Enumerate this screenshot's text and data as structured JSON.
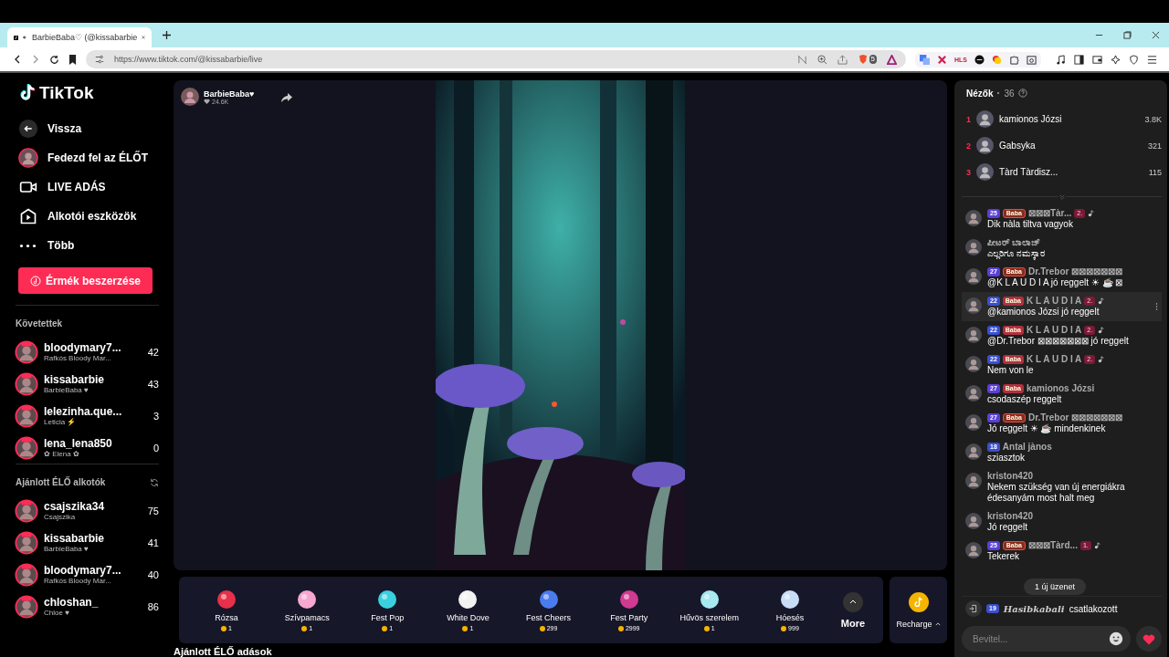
{
  "browser": {
    "tab_title": "BarbieBaba♡ (@kissabarbie",
    "url": "https://www.tiktok.com/@kissabarbie/live",
    "extension_label": "HLS",
    "shield_count": "5"
  },
  "sidebar": {
    "logo": "TikTok",
    "nav": [
      {
        "kind": "back",
        "label": "Vissza"
      },
      {
        "kind": "avatar",
        "label": "Fedezd fel az ÉLŐT"
      },
      {
        "kind": "camera",
        "label": "LIVE ADÁS"
      },
      {
        "kind": "play",
        "label": "Alkotói eszközök"
      },
      {
        "kind": "dots",
        "label": "Több"
      }
    ],
    "coins_button": "Érmék beszerzése",
    "sections": [
      {
        "title": "Követettek",
        "refresh": false,
        "items": [
          {
            "name": "bloodymary7...",
            "subtitle": "Rafkós Bloody Mar...",
            "count": "42",
            "live": true
          },
          {
            "name": "kissabarbie",
            "subtitle": "BarbieBaba ♥",
            "count": "43",
            "live": true
          },
          {
            "name": "lelezinha.que...",
            "subtitle": "Leticia ⚡",
            "count": "3",
            "live": true
          },
          {
            "name": "lena_lena850",
            "subtitle": "✿ Elena ✿",
            "count": "0",
            "live": true
          }
        ]
      },
      {
        "title": "Ajánlott ÉLŐ alkotók",
        "refresh": true,
        "items": [
          {
            "name": "csajszika34",
            "subtitle": "Csajszika",
            "count": "75",
            "live": true
          },
          {
            "name": "kissabarbie",
            "subtitle": "BarbieBaba ♥",
            "count": "41",
            "live": true
          },
          {
            "name": "bloodymary7...",
            "subtitle": "Rafkós Bloody Mar...",
            "count": "40",
            "live": true
          },
          {
            "name": "chloshan_",
            "subtitle": "Chloe ♥",
            "count": "86",
            "live": true
          }
        ]
      }
    ]
  },
  "stream": {
    "host_name": "BarbieBaba♥",
    "likes": "24.6K"
  },
  "gifts": [
    {
      "name": "Rózsa",
      "price": "1",
      "color": "#e8304a"
    },
    {
      "name": "Szívpamacs",
      "price": "1",
      "color": "#f7a8d0"
    },
    {
      "name": "Fest Pop",
      "price": "1",
      "color": "#3ad0e0"
    },
    {
      "name": "White Dove",
      "price": "1",
      "color": "#f2f2f2"
    },
    {
      "name": "Fest Cheers",
      "price": "299",
      "color": "#4a7cf0"
    },
    {
      "name": "Fest Party",
      "price": "2999",
      "color": "#d03a90"
    },
    {
      "name": "Hűvös szerelem",
      "price": "1",
      "color": "#a8e8f0"
    },
    {
      "name": "Hóesés",
      "price": "999",
      "color": "#c8dcf8"
    }
  ],
  "more_button": "More",
  "recharge_button": "Recharge",
  "below_heading": "Ajánlott ÉLŐ adások",
  "viewers": {
    "title": "Nézők",
    "count": "36",
    "top": [
      {
        "rank": "1",
        "name": "kamionos Józsi",
        "score": "3.8K"
      },
      {
        "rank": "2",
        "name": "Gabsyka",
        "score": "321"
      },
      {
        "rank": "3",
        "name": "Tàrd Tàrdisz...",
        "score": "115"
      }
    ]
  },
  "chat": [
    {
      "level": "25",
      "fan": {
        "label": "Baba",
        "kind": "outlined"
      },
      "name": "⊠⊠⊠Tàr...",
      "rank": "2.",
      "text": "Dik nàla tiltva vagyok",
      "highlighted": false
    },
    {
      "name": "ಪೀಟರ್ ಬಾಲಾಜ್",
      "text": "ಎಲ್ಲರಿಗೂ ನಮಸ್ಕಾರ",
      "highlighted": false
    },
    {
      "level": "27",
      "fan": {
        "label": "Baba",
        "kind": "outlined"
      },
      "name": "Dr.Trebor ⊠⊠⊠⊠⊠⊠⊠",
      "text": "@K L A U D I A jó reggelt ☀ ☕ ⊠",
      "highlighted": false
    },
    {
      "level": "22",
      "fan": {
        "label": "Baba",
        "kind": "filled"
      },
      "name": "K L A U D I A",
      "rank": "2.",
      "text": "@kamionos Józsi jó reggelt",
      "highlighted": true
    },
    {
      "level": "22",
      "fan": {
        "label": "Baba",
        "kind": "filled"
      },
      "name": "K L A U D I A",
      "rank": "2.",
      "text": "@Dr.Trebor ⊠⊠⊠⊠⊠⊠⊠ jó reggelt",
      "highlighted": false
    },
    {
      "level": "22",
      "fan": {
        "label": "Baba",
        "kind": "filled"
      },
      "name": "K L A U D I A",
      "rank": "2.",
      "text": "Nem von le",
      "highlighted": false
    },
    {
      "level": "27",
      "fan": {
        "label": "Baba",
        "kind": "filled"
      },
      "name": "kamionos Józsi",
      "text": "csodaszép reggelt",
      "highlighted": false
    },
    {
      "level": "27",
      "fan": {
        "label": "Baba",
        "kind": "outlined"
      },
      "name": "Dr.Trebor ⊠⊠⊠⊠⊠⊠⊠",
      "text": "Jó reggelt ☀ ☕ mindenkinek",
      "highlighted": false
    },
    {
      "level": "18",
      "name": "Antal jànos",
      "text": "sziasztok",
      "highlighted": false
    },
    {
      "name": "kriston420",
      "text": "Nekem szükség van új energiákra édesanyám most halt meg",
      "highlighted": false
    },
    {
      "name": "kriston420",
      "text": "Jó reggelt",
      "highlighted": false
    },
    {
      "level": "25",
      "fan": {
        "label": "Baba",
        "kind": "outlined"
      },
      "name": "⊠⊠⊠Tàrd...",
      "rank": "1.",
      "text": "Tekerek",
      "highlighted": false
    }
  ],
  "new_messages": "1 új üzenet",
  "join_notice": {
    "level": "19",
    "name": "Hasibkabali",
    "text": "csatlakozott"
  },
  "input": {
    "placeholder": "Bevitel..."
  }
}
